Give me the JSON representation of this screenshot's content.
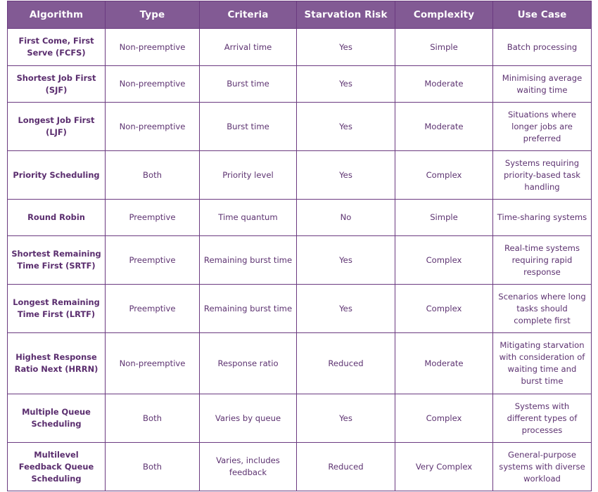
{
  "table": {
    "headers": [
      "Algorithm",
      "Type",
      "Criteria",
      "Starvation Risk",
      "Complexity",
      "Use Case"
    ],
    "rows": [
      {
        "algorithm": "First Come, First Serve (FCFS)",
        "type": "Non-preemptive",
        "criteria": "Arrival time",
        "starvation_risk": "Yes",
        "complexity": "Simple",
        "use_case": "Batch processing"
      },
      {
        "algorithm": "Shortest Job First (SJF)",
        "type": "Non-preemptive",
        "criteria": "Burst time",
        "starvation_risk": "Yes",
        "complexity": "Moderate",
        "use_case": "Minimising average waiting time"
      },
      {
        "algorithm": "Longest Job First (LJF)",
        "type": "Non-preemptive",
        "criteria": "Burst time",
        "starvation_risk": "Yes",
        "complexity": "Moderate",
        "use_case": "Situations where longer jobs are preferred"
      },
      {
        "algorithm": "Priority Scheduling",
        "type": "Both",
        "criteria": "Priority level",
        "starvation_risk": "Yes",
        "complexity": "Complex",
        "use_case": "Systems requiring priority-based task handling"
      },
      {
        "algorithm": "Round Robin",
        "type": "Preemptive",
        "criteria": "Time quantum",
        "starvation_risk": "No",
        "complexity": "Simple",
        "use_case": "Time-sharing systems"
      },
      {
        "algorithm": "Shortest Remaining Time First (SRTF)",
        "type": "Preemptive",
        "criteria": "Remaining burst time",
        "starvation_risk": "Yes",
        "complexity": "Complex",
        "use_case": "Real-time systems requiring rapid response"
      },
      {
        "algorithm": "Longest Remaining Time First (LRTF)",
        "type": "Preemptive",
        "criteria": "Remaining burst time",
        "starvation_risk": "Yes",
        "complexity": "Complex",
        "use_case": "Scenarios where long tasks should complete first"
      },
      {
        "algorithm": "Highest Response Ratio Next (HRRN)",
        "type": "Non-preemptive",
        "criteria": "Response ratio",
        "starvation_risk": "Reduced",
        "complexity": "Moderate",
        "use_case": "Mitigating starvation with consideration of waiting time and burst time"
      },
      {
        "algorithm": "Multiple Queue Scheduling",
        "type": "Both",
        "criteria": "Varies by queue",
        "starvation_risk": "Yes",
        "complexity": "Complex",
        "use_case": "Systems with different types of processes"
      },
      {
        "algorithm": "Multilevel Feedback Queue Scheduling",
        "type": "Both",
        "criteria": "Varies, includes feedback",
        "starvation_risk": "Reduced",
        "complexity": "Very Complex",
        "use_case": "General-purpose systems with diverse workload"
      }
    ]
  },
  "colors": {
    "header_bg": "#825a94",
    "border": "#6b3a80",
    "text": "#5d3371"
  }
}
